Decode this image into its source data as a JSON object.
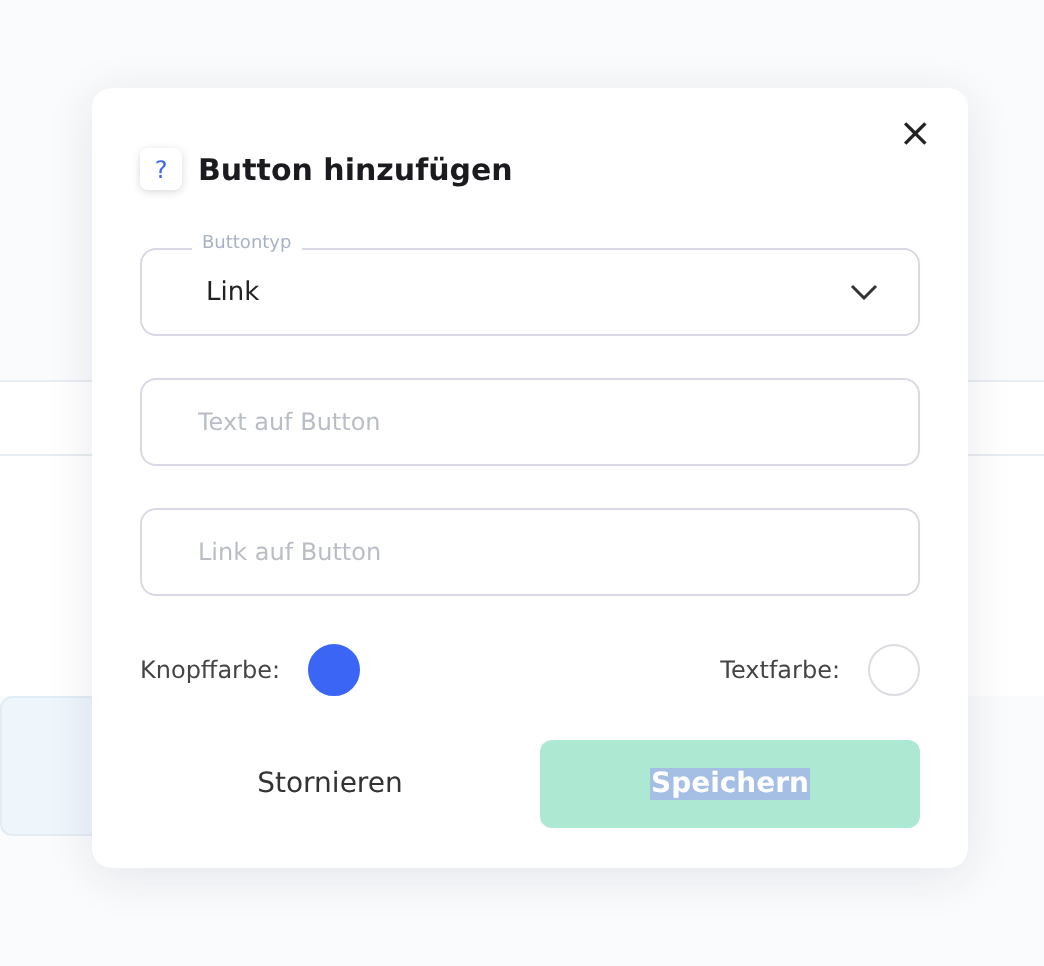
{
  "dialog": {
    "title": "Button hinzufügen",
    "help_icon": "?",
    "close": "×",
    "button_type": {
      "label": "Buttontyp",
      "value": "Link"
    },
    "fields": [
      {
        "placeholder": "Text auf Button"
      },
      {
        "placeholder": "Link auf Button"
      }
    ],
    "colors": [
      {
        "label": "Knopffarbe:",
        "color": "#3b66f5"
      },
      {
        "label": "Textfarbe:",
        "color": "#ffffff"
      }
    ],
    "cancel": "Stornieren",
    "save": {
      "label": "Speichern",
      "disabled": true,
      "text_selected": true
    }
  }
}
